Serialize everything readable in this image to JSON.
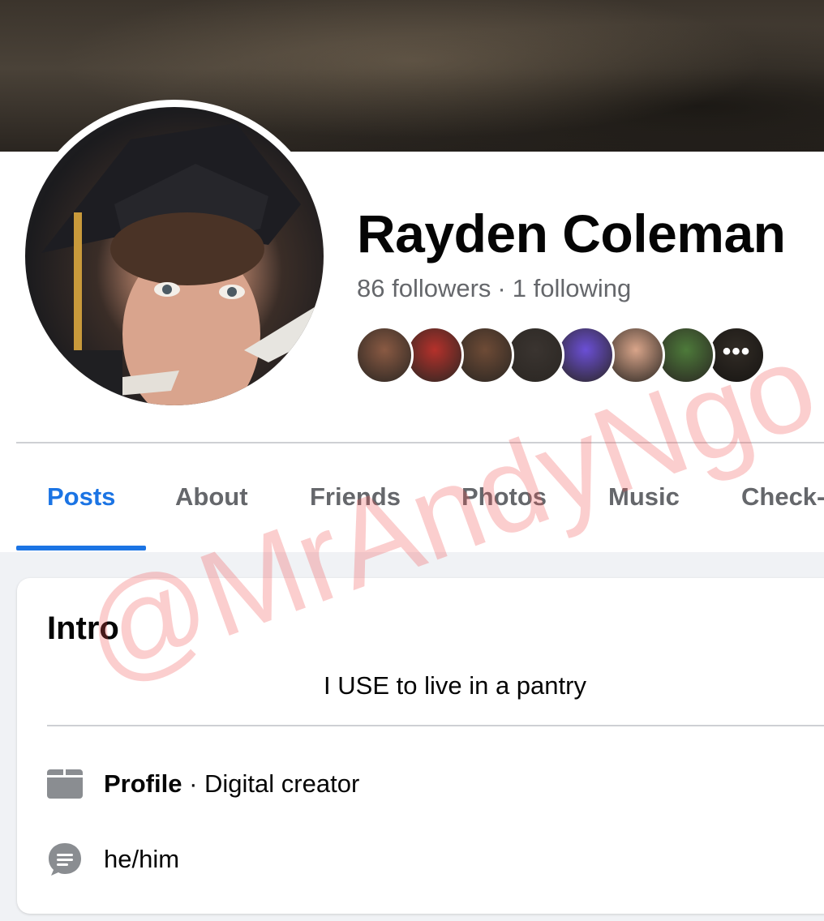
{
  "profile": {
    "name": "Rayden Coleman",
    "followers": "86 followers",
    "separator": "·",
    "following": "1 following",
    "friend_avatars": [
      {
        "name": "friend-avatar-1",
        "color": "#8a5a43"
      },
      {
        "name": "friend-avatar-2",
        "color": "#b5312b"
      },
      {
        "name": "friend-avatar-3",
        "color": "#6e4b36"
      },
      {
        "name": "friend-avatar-4",
        "color": "#3a3430"
      },
      {
        "name": "friend-avatar-5",
        "color": "#6b4fd6"
      },
      {
        "name": "friend-avatar-6",
        "color": "#d9a58a"
      },
      {
        "name": "friend-avatar-7",
        "color": "#4d7a3a"
      },
      {
        "name": "friend-avatar-8",
        "color": "#5a5045"
      }
    ],
    "more_label": "•••"
  },
  "tabs": [
    {
      "label": "Posts",
      "active": true
    },
    {
      "label": "About",
      "active": false
    },
    {
      "label": "Friends",
      "active": false
    },
    {
      "label": "Photos",
      "active": false
    },
    {
      "label": "Music",
      "active": false
    },
    {
      "label": "Check-",
      "active": false
    }
  ],
  "intro": {
    "title": "Intro",
    "bio": "I USE to live in a pantry",
    "profile_label": "Profile",
    "profile_separator": " · ",
    "profile_category": "Digital creator",
    "pronouns": "he/him"
  },
  "watermark": "@MrAndyNgo",
  "colors": {
    "accent": "#1b74e4",
    "secondary_text": "#65676b",
    "background": "#f0f2f5"
  }
}
